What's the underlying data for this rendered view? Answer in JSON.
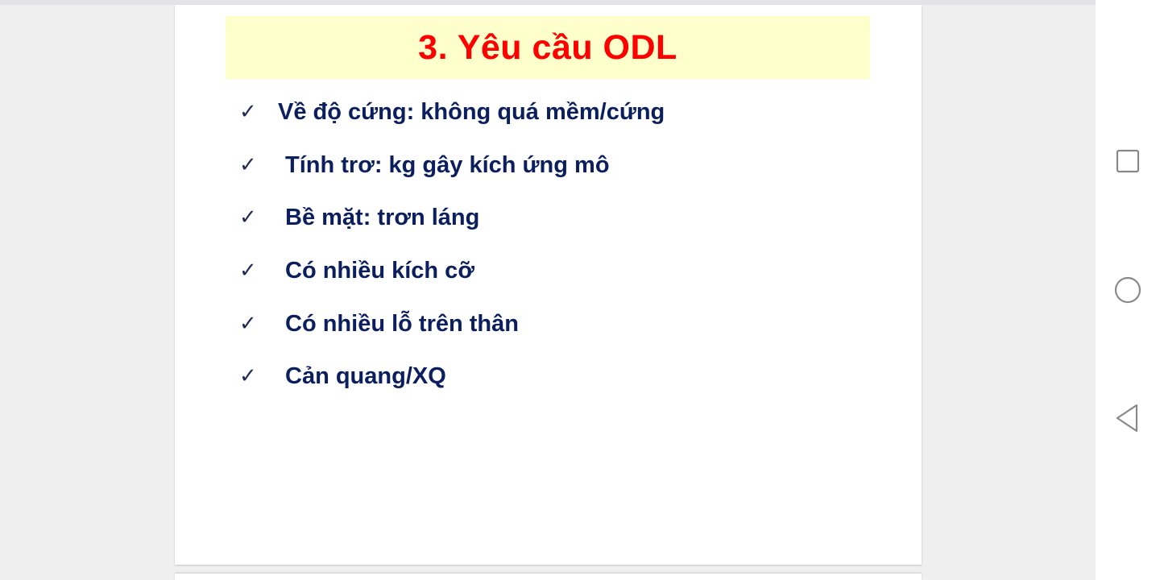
{
  "slide": {
    "title": "3. Yêu cầu ODL",
    "bullets": [
      "Về độ cứng: không quá mềm/cứng",
      "Tính trơ: kg gây kích ứng mô",
      "Bề mặt: trơn láng",
      "Có nhiều kích cỡ",
      "Có nhiều lỗ trên thân",
      "Cản quang/XQ"
    ],
    "check_mark": "✓"
  },
  "navbar": {
    "buttons": [
      {
        "icon": "recent-apps-square-icon"
      },
      {
        "icon": "home-circle-icon"
      },
      {
        "icon": "back-triangle-icon"
      }
    ]
  },
  "colors": {
    "title_text": "#ff0000",
    "title_background": "#ffffcc",
    "bullet_text": "#0b1f5e",
    "viewer_background": "#efeff0"
  }
}
